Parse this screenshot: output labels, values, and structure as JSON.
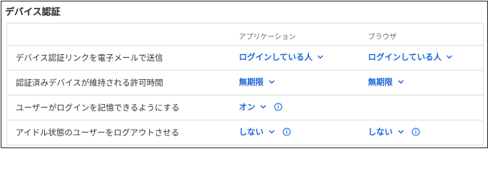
{
  "section": {
    "title": "デバイス認証"
  },
  "columns": {
    "application": "アプリケーション",
    "browser": "ブラウザ"
  },
  "rows": [
    {
      "label": "デバイス認証リンクを電子メールで送信",
      "application": "ログインしている人",
      "browser": "ログインしている人"
    },
    {
      "label": "認証済みデバイスが維持される許可時間",
      "application": "無期限",
      "browser": "無期限"
    },
    {
      "label": "ユーザーがログインを記憶できるようにする",
      "application": "オン"
    },
    {
      "label": "アイドル状態のユーザーをログアウトさせる",
      "application": "しない",
      "browser": "しない"
    }
  ],
  "icons": {
    "dropdown": "chevron-down-icon",
    "info": "info-icon"
  },
  "colors": {
    "accent": "#1a66d6",
    "border": "#dcdcdc",
    "label": "#333333",
    "header": "#666666"
  }
}
